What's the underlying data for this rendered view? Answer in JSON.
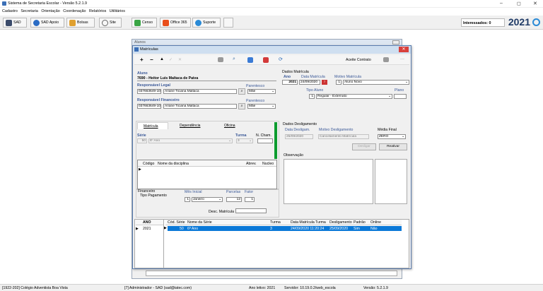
{
  "window": {
    "title": "Sistema de Secretaria Escolar - Versão 5.2.1.9",
    "min": "–",
    "max": "◻",
    "close": "✕"
  },
  "menu": [
    "Cadastro",
    "Secretaria",
    "Orientação",
    "Coordenação",
    "Relatórios",
    "Utilitários"
  ],
  "toolbar": {
    "sad": "SAD",
    "sad_apoio": "SAD Apoio",
    "bolsas": "Bolsas",
    "site": "Site",
    "censo": "Censo",
    "office": "Office 365",
    "suporte": "Suporte",
    "interessados": "Interessados: 0",
    "year": "2021"
  },
  "alunos_title": "Alunos",
  "matriculas": {
    "title": "Matrículas",
    "aceite": "Aceite Contrato",
    "aluno_label": "Aluno",
    "aluno_value": "7690 - Heitor Luis Maltaca de Paiva",
    "resp_legal_label": "Responsável Legal",
    "resp_legal_cpf": "037663649-10",
    "resp_legal_nome": "Ariane Ticiana Maltaca",
    "parentesco_label": "Parentesco",
    "parentesco_legal": "Mãe",
    "resp_fin_label": "Responsável Financeiro",
    "resp_fin_cpf": "037663649-10",
    "resp_fin_nome": "Ariane Ticiana Maltaca",
    "parentesco_fin": "Mãe",
    "dados_label": "Dados Matrícula",
    "ano_label": "Ano",
    "data_mat_label": "Data Matrícula",
    "motivo_label": "Motivo Matrícula",
    "ano_value": "2021",
    "data_mat_value": "24/09/2020",
    "motivo_num": "1",
    "motivo_value": "Aluno Novo",
    "tipo_aluno_label": "Tipo Aluno",
    "plano_label": "Plano",
    "tipo_num": "1",
    "tipo_value": "Regular - Externato",
    "tabs": [
      "Matrícula",
      "Dependência",
      "Oficina"
    ],
    "serie_label": "Série",
    "turma_label": "Turma",
    "nchamada_label": "N. Cham.",
    "serie_num": "50",
    "serie_value": "6º Ano",
    "turma_value": "3",
    "disc_cols": [
      "Código",
      "Nome da disciplina",
      "Abrev.",
      "Nucleo"
    ],
    "deslig_label": "Dados Desligamento",
    "data_deslig_label": "Data Desligam.",
    "motivo_deslig_label": "Motivo Desligamento",
    "media_label": "Média Final",
    "data_deslig_value": "25/09/2020",
    "motivo_deslig_value": "Cancelamento Matrícula",
    "media_value": "ZERO",
    "desligar_btn": "Desligar",
    "reativar_btn": "Reativar",
    "obs_label": "Observação",
    "fin_label": "Financeiro",
    "tipo_pag_label": "Tipo Pagamento",
    "mes_label": "Mês Inicial",
    "parcelas_label": "Parcelas",
    "fator_label": "Fator",
    "mes_num": "1",
    "mes_value": "Janeiro",
    "parcelas_value": "12",
    "fator_value": "1",
    "desc_label": "Desc. Matrícula",
    "ano_col": "ANO",
    "ano_row": "2021",
    "hist_cols": [
      "Cód. Série",
      "Nome da Série",
      "Turma",
      "Data Matrícula",
      "Turma",
      "Desligamento",
      "Padrão",
      "Online"
    ],
    "hist_row": [
      "50",
      "6º Ano",
      "3",
      "24/09/2020 11:20:24",
      "25/09/2020",
      "Sim",
      "Não"
    ]
  },
  "status": {
    "escola": "[1922-202] Colégio Adventista Boa Vista",
    "usuario": "[7] Administrador - SAD (sad@iatec.com)",
    "ano": "Ano letivo: 2021",
    "servidor": "Servidor: 10.19.0.2/web_escola",
    "versao": "Versão: 5.2.1.9"
  }
}
